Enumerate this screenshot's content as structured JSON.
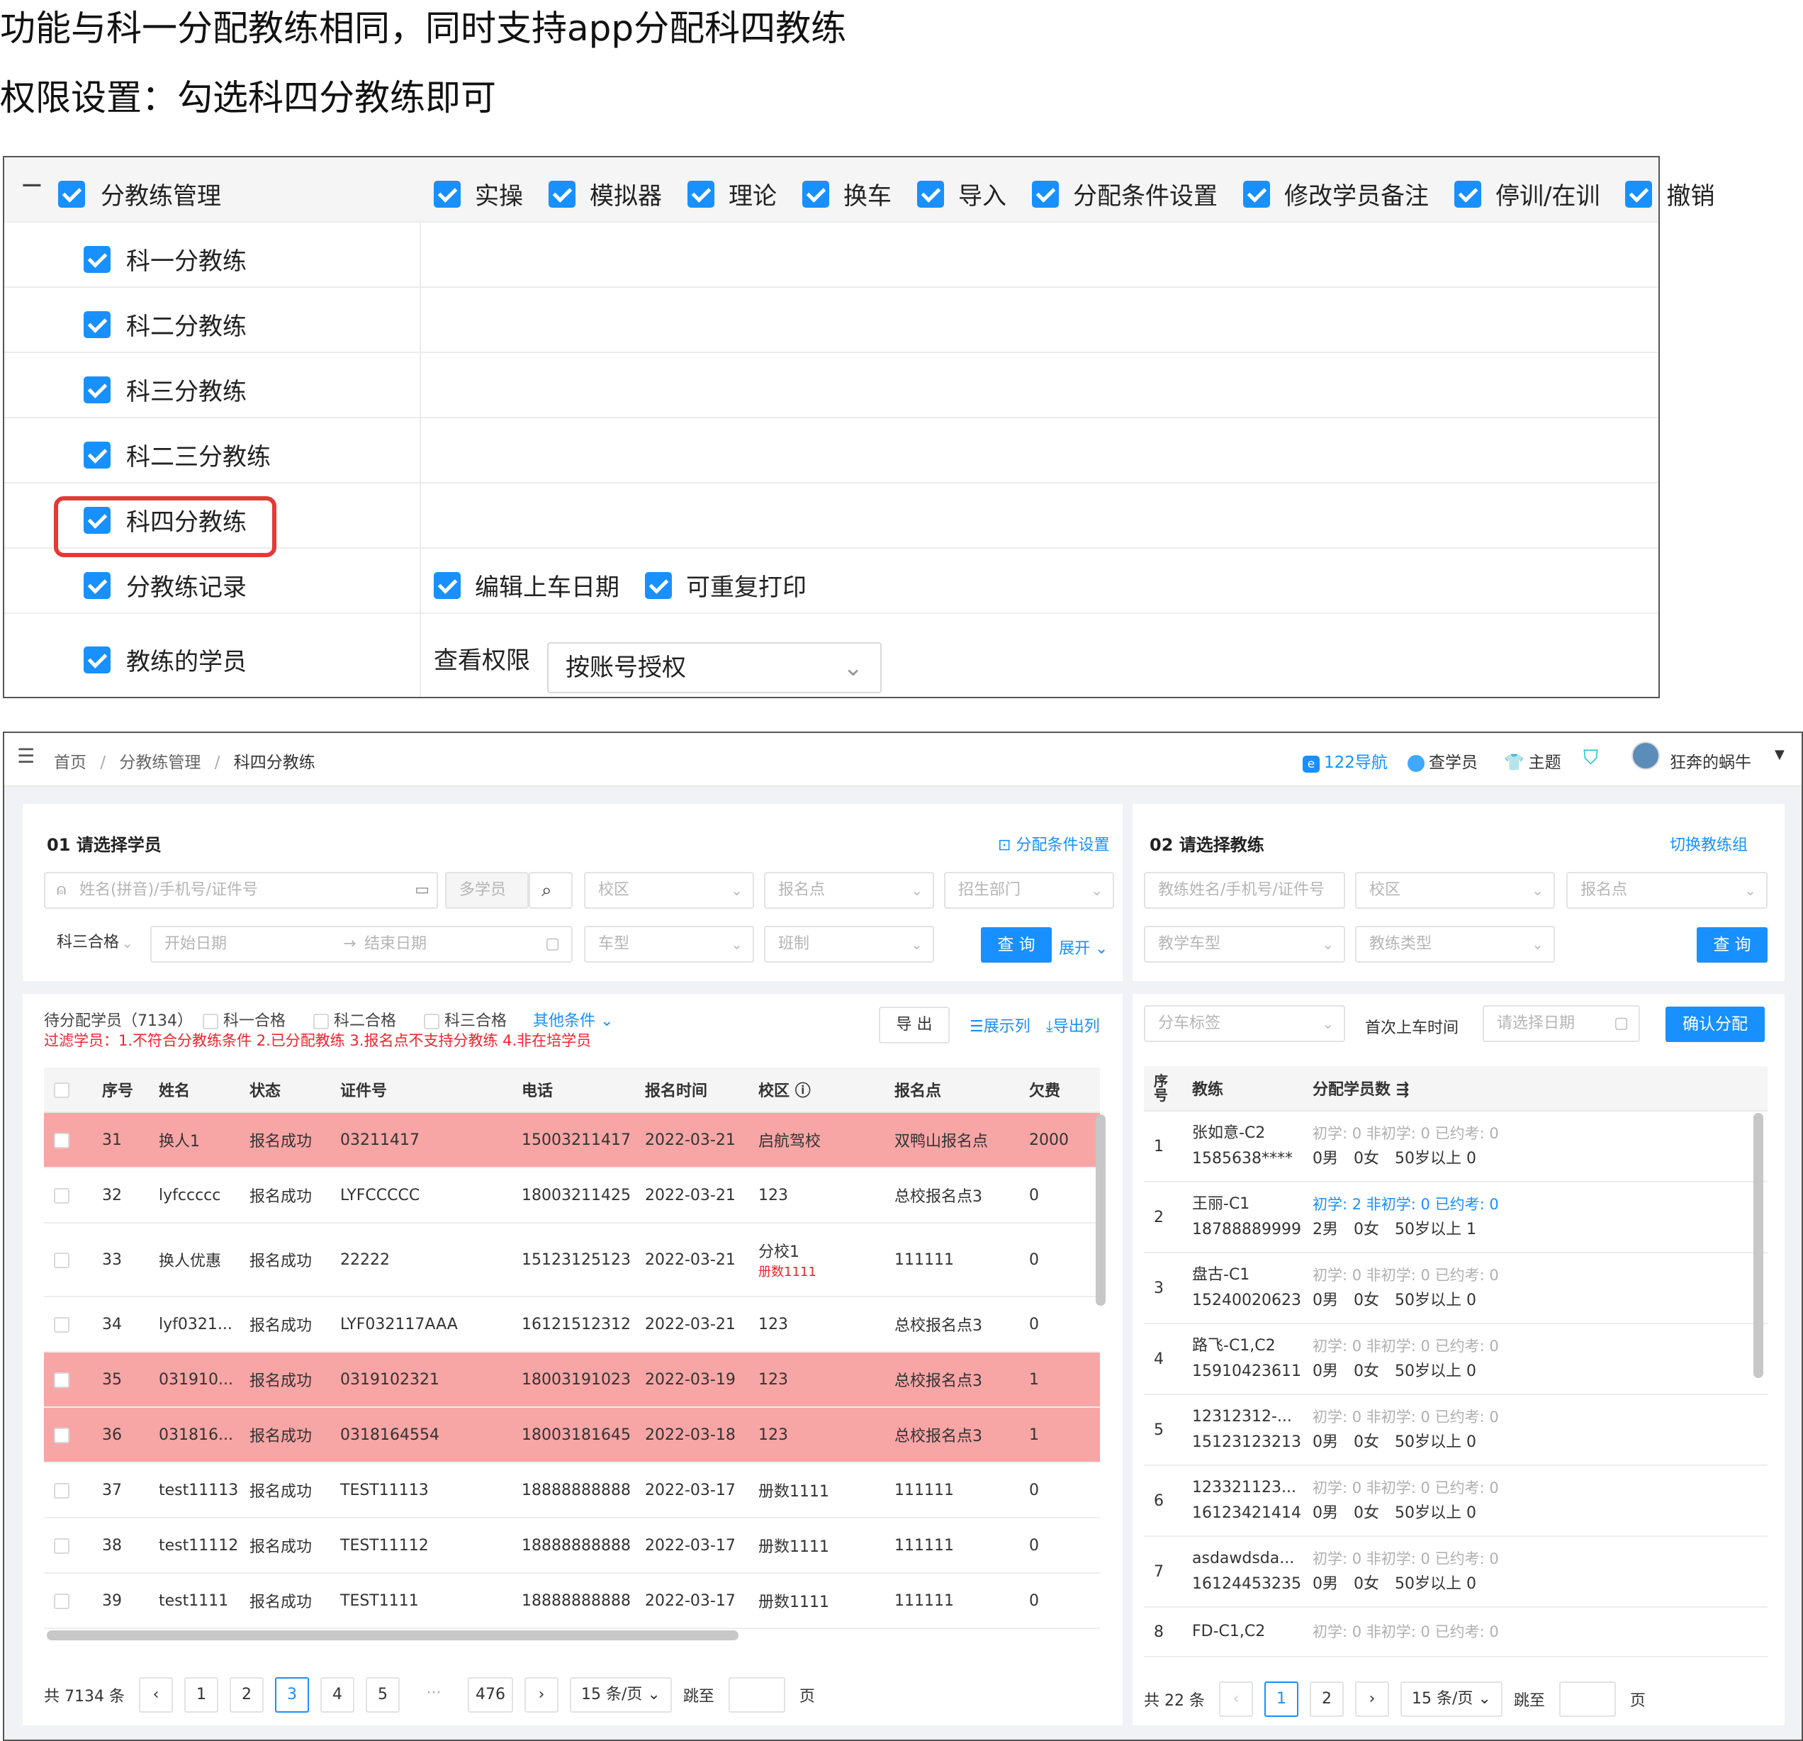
{
  "intro": {
    "line1": "功能与科一分配教练相同，同时支持app分配科四教练",
    "line2": "权限设置：勾选科四分教练即可"
  },
  "permissions": {
    "collapse_glyph": "−",
    "module": "分教练管理",
    "module_actions": [
      "实操",
      "模拟器",
      "理论",
      "换车",
      "导入",
      "分配条件设置",
      "修改学员备注",
      "停训/在训",
      "撤销"
    ],
    "items": [
      "科一分教练",
      "科二分教练",
      "科三分教练",
      "科二三分教练",
      "科四分教练",
      "分教练记录",
      "教练的学员"
    ],
    "record_actions": [
      "编辑上车日期",
      "可重复打印"
    ],
    "view_label": "查看权限",
    "view_value": "按账号授权"
  },
  "app": {
    "breadcrumb": [
      "首页",
      "分教练管理",
      "科四分教练"
    ],
    "topnav": [
      "122导航",
      "查学员",
      "主题"
    ],
    "user": "狂奔的蜗牛",
    "left": {
      "title": "01 请选择学员",
      "cond_link": "分配条件设置",
      "search_placeholder": "姓名(拼音)/手机号/证件号",
      "multi": "多学员",
      "filters": [
        "校区",
        "报名点",
        "招生部门"
      ],
      "pass_select": "科三合格",
      "start_date": "开始日期",
      "end_date": "结束日期",
      "filters2": [
        "车型",
        "班制"
      ],
      "query": "查 询",
      "expand": "展开",
      "pending": "待分配学员（7134）",
      "checks": [
        "科一合格",
        "科二合格",
        "科三合格"
      ],
      "other": "其他条件",
      "export": "导 出",
      "show_cols": "展示列",
      "export_cols": "导出列",
      "filter_note": "过滤学员：1.不符合分教练条件 2.已分配教练 3.报名点不支持分教练 4.非在培学员",
      "columns": [
        "序号",
        "姓名",
        "状态",
        "证件号",
        "电话",
        "报名时间",
        "校区",
        "报名点",
        "欠费"
      ],
      "rows": [
        {
          "no": "31",
          "name": "换人1",
          "status": "报名成功",
          "id": "03211417",
          "phone": "15003211417",
          "date": "2022-03-21",
          "campus": "启航驾校",
          "campus_sub": "",
          "point": "双鸭山报名点",
          "owe": "2000",
          "hl": true
        },
        {
          "no": "32",
          "name": "lyfccccc",
          "status": "报名成功",
          "id": "LYFCCCCC",
          "phone": "18003211425",
          "date": "2022-03-21",
          "campus": "123",
          "campus_sub": "",
          "point": "总校报名点3",
          "owe": "0",
          "hl": false
        },
        {
          "no": "33",
          "name": "换人优惠",
          "status": "报名成功",
          "id": "22222",
          "phone": "15123125123",
          "date": "2022-03-21",
          "campus": "分校1",
          "campus_sub": "册数1111",
          "point": "111111",
          "owe": "0",
          "hl": false
        },
        {
          "no": "34",
          "name": "lyf0321...",
          "status": "报名成功",
          "id": "LYF032117AAA",
          "phone": "16121512312",
          "date": "2022-03-21",
          "campus": "123",
          "campus_sub": "",
          "point": "总校报名点3",
          "owe": "0",
          "hl": false
        },
        {
          "no": "35",
          "name": "031910...",
          "status": "报名成功",
          "id": "0319102321",
          "phone": "18003191023",
          "date": "2022-03-19",
          "campus": "123",
          "campus_sub": "",
          "point": "总校报名点3",
          "owe": "1",
          "hl": true
        },
        {
          "no": "36",
          "name": "031816...",
          "status": "报名成功",
          "id": "0318164554",
          "phone": "18003181645",
          "date": "2022-03-18",
          "campus": "123",
          "campus_sub": "",
          "point": "总校报名点3",
          "owe": "1",
          "hl": true
        },
        {
          "no": "37",
          "name": "test11113",
          "status": "报名成功",
          "id": "TEST11113",
          "phone": "18888888888",
          "date": "2022-03-17",
          "campus": "册数1111",
          "campus_sub": "",
          "point": "111111",
          "owe": "0",
          "hl": false
        },
        {
          "no": "38",
          "name": "test11112",
          "status": "报名成功",
          "id": "TEST11112",
          "phone": "18888888888",
          "date": "2022-03-17",
          "campus": "册数1111",
          "campus_sub": "",
          "point": "111111",
          "owe": "0",
          "hl": false
        },
        {
          "no": "39",
          "name": "test1111",
          "status": "报名成功",
          "id": "TEST1111",
          "phone": "18888888888",
          "date": "2022-03-17",
          "campus": "册数1111",
          "campus_sub": "",
          "point": "111111",
          "owe": "0",
          "hl": false
        }
      ],
      "total": "共 7134 条",
      "pages": [
        "1",
        "2",
        "3",
        "4",
        "5",
        "···",
        "476"
      ],
      "active_page": "3",
      "page_size": "15 条/页",
      "jump": "跳至",
      "page_unit": "页"
    },
    "right": {
      "title": "02 请选择教练",
      "switch_link": "切换教练组",
      "search_placeholder": "教练姓名/手机号/证件号",
      "filters": [
        "校区",
        "报名点"
      ],
      "filters2": [
        "教学车型",
        "教练类型"
      ],
      "query": "查 询",
      "tag_select": "分车标签",
      "first_time_label": "首次上车时间",
      "date_placeholder": "请选择日期",
      "confirm": "确认分配",
      "columns": [
        "序号",
        "教练",
        "分配学员数"
      ],
      "rows": [
        {
          "no": "1",
          "name": "张如意-C2",
          "phone": "1585638****",
          "stat": "初学: 0 非初学: 0 已约考: 0",
          "sub": "0男　0女　50岁以上 0",
          "hl": false
        },
        {
          "no": "2",
          "name": "王丽-C1",
          "phone": "18788889999",
          "stat": "初学: 2 非初学: 0 已约考: 0",
          "sub": "2男　0女　50岁以上 1",
          "hl": true
        },
        {
          "no": "3",
          "name": "盘古-C1",
          "phone": "15240020623",
          "stat": "初学: 0 非初学: 0 已约考: 0",
          "sub": "0男　0女　50岁以上 0",
          "hl": false
        },
        {
          "no": "4",
          "name": "路飞-C1,C2",
          "phone": "15910423611",
          "stat": "初学: 0 非初学: 0 已约考: 0",
          "sub": "0男　0女　50岁以上 0",
          "hl": false
        },
        {
          "no": "5",
          "name": "12312312-...",
          "phone": "15123123213",
          "stat": "初学: 0 非初学: 0 已约考: 0",
          "sub": "0男　0女　50岁以上 0",
          "hl": false
        },
        {
          "no": "6",
          "name": "123321123...",
          "phone": "16123421414",
          "stat": "初学: 0 非初学: 0 已约考: 0",
          "sub": "0男　0女　50岁以上 0",
          "hl": false
        },
        {
          "no": "7",
          "name": "asdawdsda...",
          "phone": "16124453235",
          "stat": "初学: 0 非初学: 0 已约考: 0",
          "sub": "0男　0女　50岁以上 0",
          "hl": false
        },
        {
          "no": "8",
          "name": "FD-C1,C2",
          "phone": "",
          "stat": "初学: 0 非初学: 0 已约考: 0",
          "sub": "",
          "hl": false
        }
      ],
      "total": "共 22 条",
      "pages": [
        "1",
        "2"
      ],
      "active_page": "1",
      "page_size": "15 条/页",
      "jump": "跳至",
      "page_unit": "页"
    }
  },
  "colors": {
    "accent": "#1890ff",
    "highlight_row": "#f8a5a5",
    "annotation": "#e53935",
    "note": "#f5222d"
  }
}
